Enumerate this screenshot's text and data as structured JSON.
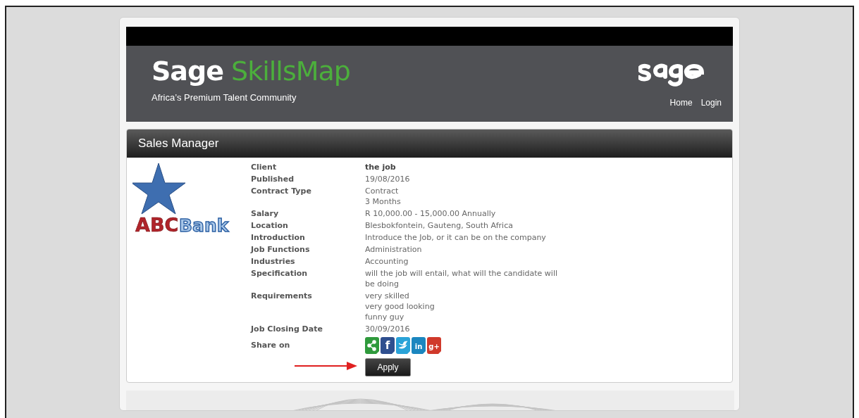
{
  "header": {
    "brand": "Sage",
    "product": "SkillsMap",
    "tagline": "Africa’s Premium Talent Community",
    "nav": [
      "Home",
      "Login"
    ]
  },
  "job": {
    "title": "Sales Manager",
    "logo_text": [
      "ABC",
      "Bank"
    ],
    "details": [
      {
        "label": "Client",
        "values": [
          "the job"
        ],
        "bold": true
      },
      {
        "label": "Published",
        "values": [
          "19/08/2016"
        ],
        "bold": false
      },
      {
        "label": "Contract Type",
        "values": [
          "Contract",
          "3 Months"
        ],
        "bold": false
      },
      {
        "label": "Salary",
        "values": [
          "R 10,000.00 - 15,000.00 Annually"
        ],
        "bold": false
      },
      {
        "label": "Location",
        "values": [
          "Blesbokfontein, Gauteng, South Africa"
        ],
        "bold": false
      },
      {
        "label": "Introduction",
        "values": [
          "Introduce the Job, or it can be on the company"
        ],
        "bold": false
      },
      {
        "label": "Job Functions",
        "values": [
          "Administration"
        ],
        "bold": false
      },
      {
        "label": "Industries",
        "values": [
          "Accounting"
        ],
        "bold": false
      },
      {
        "label": "Specification",
        "values": [
          "will the job will entail, what will the candidate will be doing"
        ],
        "bold": false
      },
      {
        "label": "Requirements",
        "values": [
          "very skilled",
          "very good looking",
          "funny guy"
        ],
        "bold": false
      },
      {
        "label": "Job Closing Date",
        "values": [
          "30/09/2016"
        ],
        "bold": false
      }
    ],
    "share_label": "Share on",
    "share": [
      {
        "kind": "share",
        "color": "#2f9a3c"
      },
      {
        "kind": "facebook",
        "color": "#2f4f8f",
        "glyph": "f"
      },
      {
        "kind": "twitter",
        "color": "#2aa3d8"
      },
      {
        "kind": "linkedin",
        "color": "#1b86bf",
        "glyph": "in"
      },
      {
        "kind": "googleplus",
        "color": "#d0392b",
        "glyph": "g+"
      }
    ],
    "apply": "Apply"
  }
}
